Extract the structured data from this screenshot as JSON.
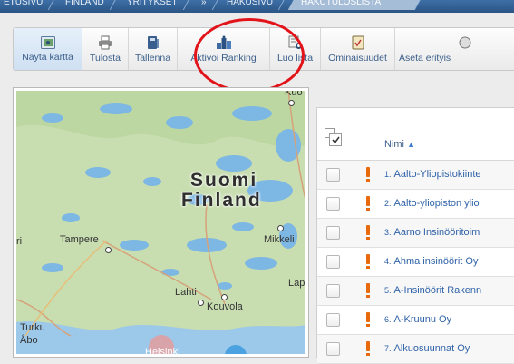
{
  "breadcrumb": [
    {
      "label": "ETUSIVU"
    },
    {
      "label": "FINLAND"
    },
    {
      "label": "YRITYKSET"
    },
    {
      "label": "»"
    },
    {
      "label": "HAKUSIVU"
    },
    {
      "label": "HAKUTULOSLISTA"
    }
  ],
  "toolbar": [
    {
      "label": "Näytä kartta",
      "icon": "map-icon",
      "active": true
    },
    {
      "label": "Tulosta",
      "icon": "printer-icon"
    },
    {
      "label": "Tallenna",
      "icon": "save-icon"
    },
    {
      "label": "Aktivoi Ranking",
      "icon": "ranking-icon"
    },
    {
      "label": "Luo lista",
      "icon": "list-icon"
    },
    {
      "label": "Ominaisuudet",
      "icon": "properties-icon"
    },
    {
      "label": "Aseta erityis",
      "icon": "special-icon"
    }
  ],
  "map": {
    "country_fi": "Suomi",
    "country_en": "Finland",
    "cities": [
      {
        "name": "Tampere"
      },
      {
        "name": "Mikkeli"
      },
      {
        "name": "Lahti"
      },
      {
        "name": "Kouvola"
      },
      {
        "name": "Turku"
      },
      {
        "name": "Åbo"
      },
      {
        "name": "Helsinki"
      },
      {
        "name": "Kuo"
      },
      {
        "name": "Lap"
      },
      {
        "name": "ri"
      }
    ]
  },
  "table": {
    "column_name": "Nimi",
    "rows": [
      {
        "num": "1.",
        "name": "Aalto-Yliopistokiinte"
      },
      {
        "num": "2.",
        "name": "Aalto-yliopiston ylio"
      },
      {
        "num": "3.",
        "name": "Aarno Insinööritoim"
      },
      {
        "num": "4.",
        "name": "Ahma insinöörit Oy"
      },
      {
        "num": "5.",
        "name": "A-Insinöörit Rakenn"
      },
      {
        "num": "6.",
        "name": "A-Kruunu Oy"
      },
      {
        "num": "7.",
        "name": "Alkuosuunnat Oy"
      }
    ]
  },
  "colors": {
    "accent": "#3b5f8a",
    "link": "#2f62a8",
    "highlight": "#e2141a",
    "warning": "#e86a0c"
  }
}
